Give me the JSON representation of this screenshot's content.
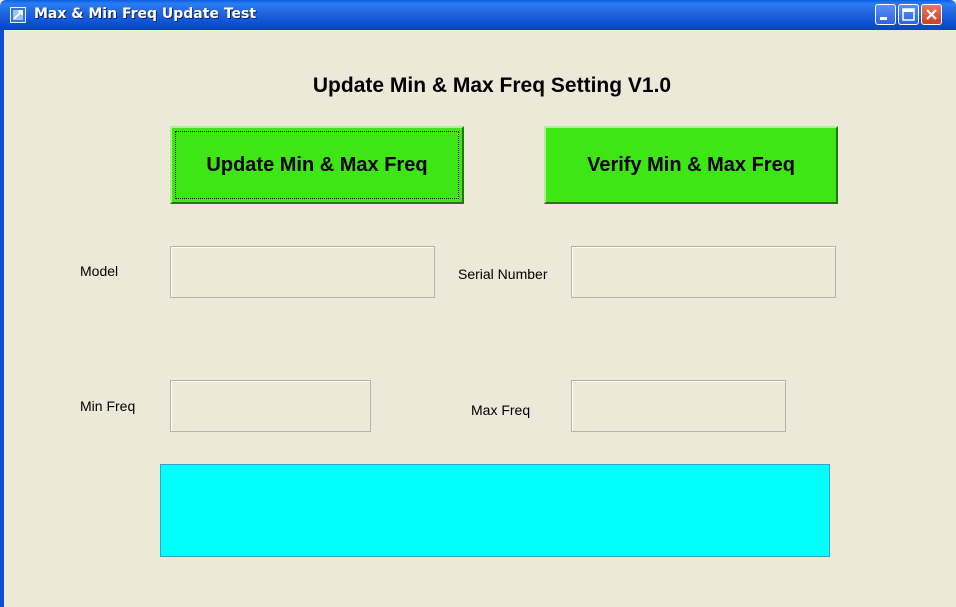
{
  "window": {
    "title": "Max & Min Freq Update Test",
    "icon": "java-app-icon",
    "controls": [
      "minimize-icon",
      "maximize-icon",
      "close-icon"
    ]
  },
  "main": {
    "heading": "Update Min & Max Freq Setting  V1.0",
    "buttons": {
      "update_label": "Update Min & Max Freq",
      "verify_label": "Verify Min & Max Freq"
    },
    "fields": {
      "model": {
        "label": "Model",
        "value": ""
      },
      "serial_number": {
        "label": "Serial Number",
        "value": ""
      },
      "min_freq": {
        "label": "Min Freq",
        "value": ""
      },
      "max_freq": {
        "label": "Max Freq",
        "value": ""
      }
    },
    "status": {
      "text": ""
    }
  },
  "colors": {
    "button_green": "#3de614",
    "status_cyan": "#00ffff",
    "window_bg": "#ece9d8",
    "titlebar_blue": "#0c4fd2"
  }
}
